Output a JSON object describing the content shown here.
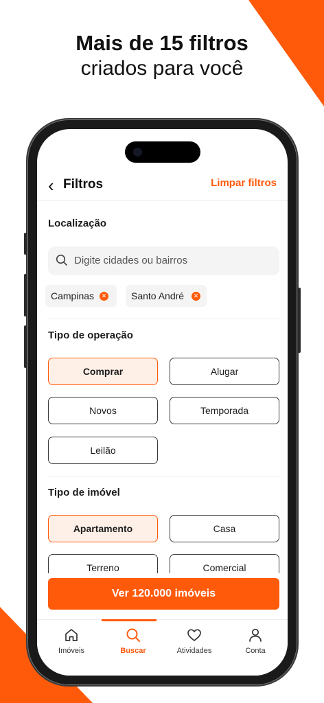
{
  "promo": {
    "headline_bold": "Mais de 15 filtros",
    "headline_regular": "criados para você"
  },
  "colors": {
    "accent": "#ff5a0a",
    "selected_bg": "#fff0e7"
  },
  "header": {
    "title": "Filtros",
    "clear_label": "Limpar filtros",
    "back_icon": "chevron-left-icon"
  },
  "location": {
    "title": "Localização",
    "search_placeholder": "Digite cidades ou bairros",
    "chips": [
      {
        "label": "Campinas"
      },
      {
        "label": "Santo André"
      }
    ]
  },
  "operation": {
    "title": "Tipo de operação",
    "options": [
      {
        "label": "Comprar",
        "selected": true
      },
      {
        "label": "Alugar",
        "selected": false
      },
      {
        "label": "Novos",
        "selected": false
      },
      {
        "label": "Temporada",
        "selected": false
      },
      {
        "label": "Leilão",
        "selected": false
      }
    ]
  },
  "property": {
    "title": "Tipo de imóvel",
    "options": [
      {
        "label": "Apartamento",
        "selected": true
      },
      {
        "label": "Casa",
        "selected": false
      },
      {
        "label": "Terreno",
        "selected": false
      },
      {
        "label": "Comercial",
        "selected": false
      }
    ]
  },
  "cta": {
    "label": "Ver 120.000 imóveis"
  },
  "tabbar": {
    "items": [
      {
        "label": "Imóveis",
        "icon": "home-icon",
        "active": false
      },
      {
        "label": "Buscar",
        "icon": "search-icon",
        "active": true
      },
      {
        "label": "Atividades",
        "icon": "heart-icon",
        "active": false
      },
      {
        "label": "Conta",
        "icon": "user-icon",
        "active": false
      }
    ]
  }
}
